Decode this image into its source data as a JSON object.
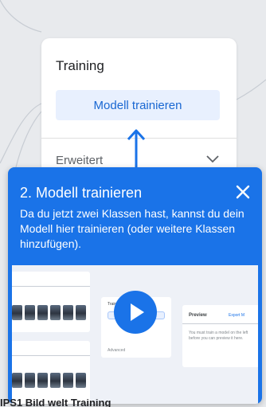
{
  "training_card": {
    "title": "Training",
    "train_button_label": "Modell trainieren",
    "advanced_label": "Erweitert"
  },
  "tooltip": {
    "title": "2. Modell trainieren",
    "description": "Da du jetzt zwei Klassen hast, kannst du dein Modell hier trainieren (oder weitere Klassen hinzufügen).",
    "close_icon": "close-icon",
    "video": {
      "training_label": "Training",
      "preview_label": "Preview",
      "export_label": "Export M",
      "preview_note": "You must train a model on the left before you can preview it here.",
      "advanced_label": "Advanced",
      "play_icon": "play-icon"
    }
  },
  "bottom_caption": "IPS1 Bild welt Training",
  "colors": {
    "accent": "#1a73e8",
    "button_bg": "#e8f0fe",
    "button_text": "#1967d2",
    "background": "#e8eaed"
  }
}
